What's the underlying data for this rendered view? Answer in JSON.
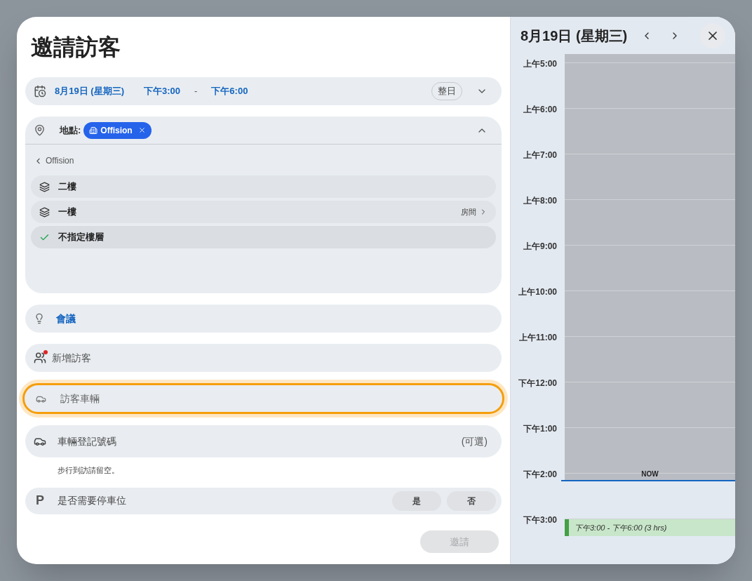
{
  "dialog": {
    "title": "邀請訪客"
  },
  "date_field": {
    "date": "8月19日 (星期三)",
    "start": "下午3:00",
    "separator": "-",
    "end": "下午6:00",
    "all_day_button": "整日",
    "expanded": false
  },
  "location": {
    "label": "地點:",
    "chip": "Offision",
    "expanded": true,
    "back_label": "Offision",
    "floors": [
      {
        "label": "二樓",
        "selected": false
      },
      {
        "label": "一樓",
        "action": "房間",
        "selected": false
      },
      {
        "label": "不指定樓層",
        "selected": true
      }
    ]
  },
  "meeting_field": {
    "value": "會議"
  },
  "visitors_field": {
    "placeholder": "新增訪客"
  },
  "vehicle_field": {
    "placeholder": "訪客車輛",
    "focused": true
  },
  "plate_field": {
    "placeholder": "車輛登記號碼",
    "optional_label": "(可選)"
  },
  "hint": "步行到訪請留空。",
  "parking": {
    "icon_text": "P",
    "label": "是否需要停車位",
    "options": [
      {
        "label": "是",
        "selected": false
      },
      {
        "label": "否",
        "selected": false
      }
    ]
  },
  "invite_button": {
    "label": "邀請",
    "disabled": true
  },
  "calendar": {
    "date": "8月19日 (星期三)",
    "hours": [
      "上午5:00",
      "上午6:00",
      "上午7:00",
      "上午8:00",
      "上午9:00",
      "上午10:00",
      "上午11:00",
      "下午12:00",
      "下午1:00",
      "下午2:00",
      "下午3:00"
    ],
    "now_label": "NOW",
    "event": {
      "label": "下午3:00 - 下午6:00 (3 hrs)"
    }
  }
}
